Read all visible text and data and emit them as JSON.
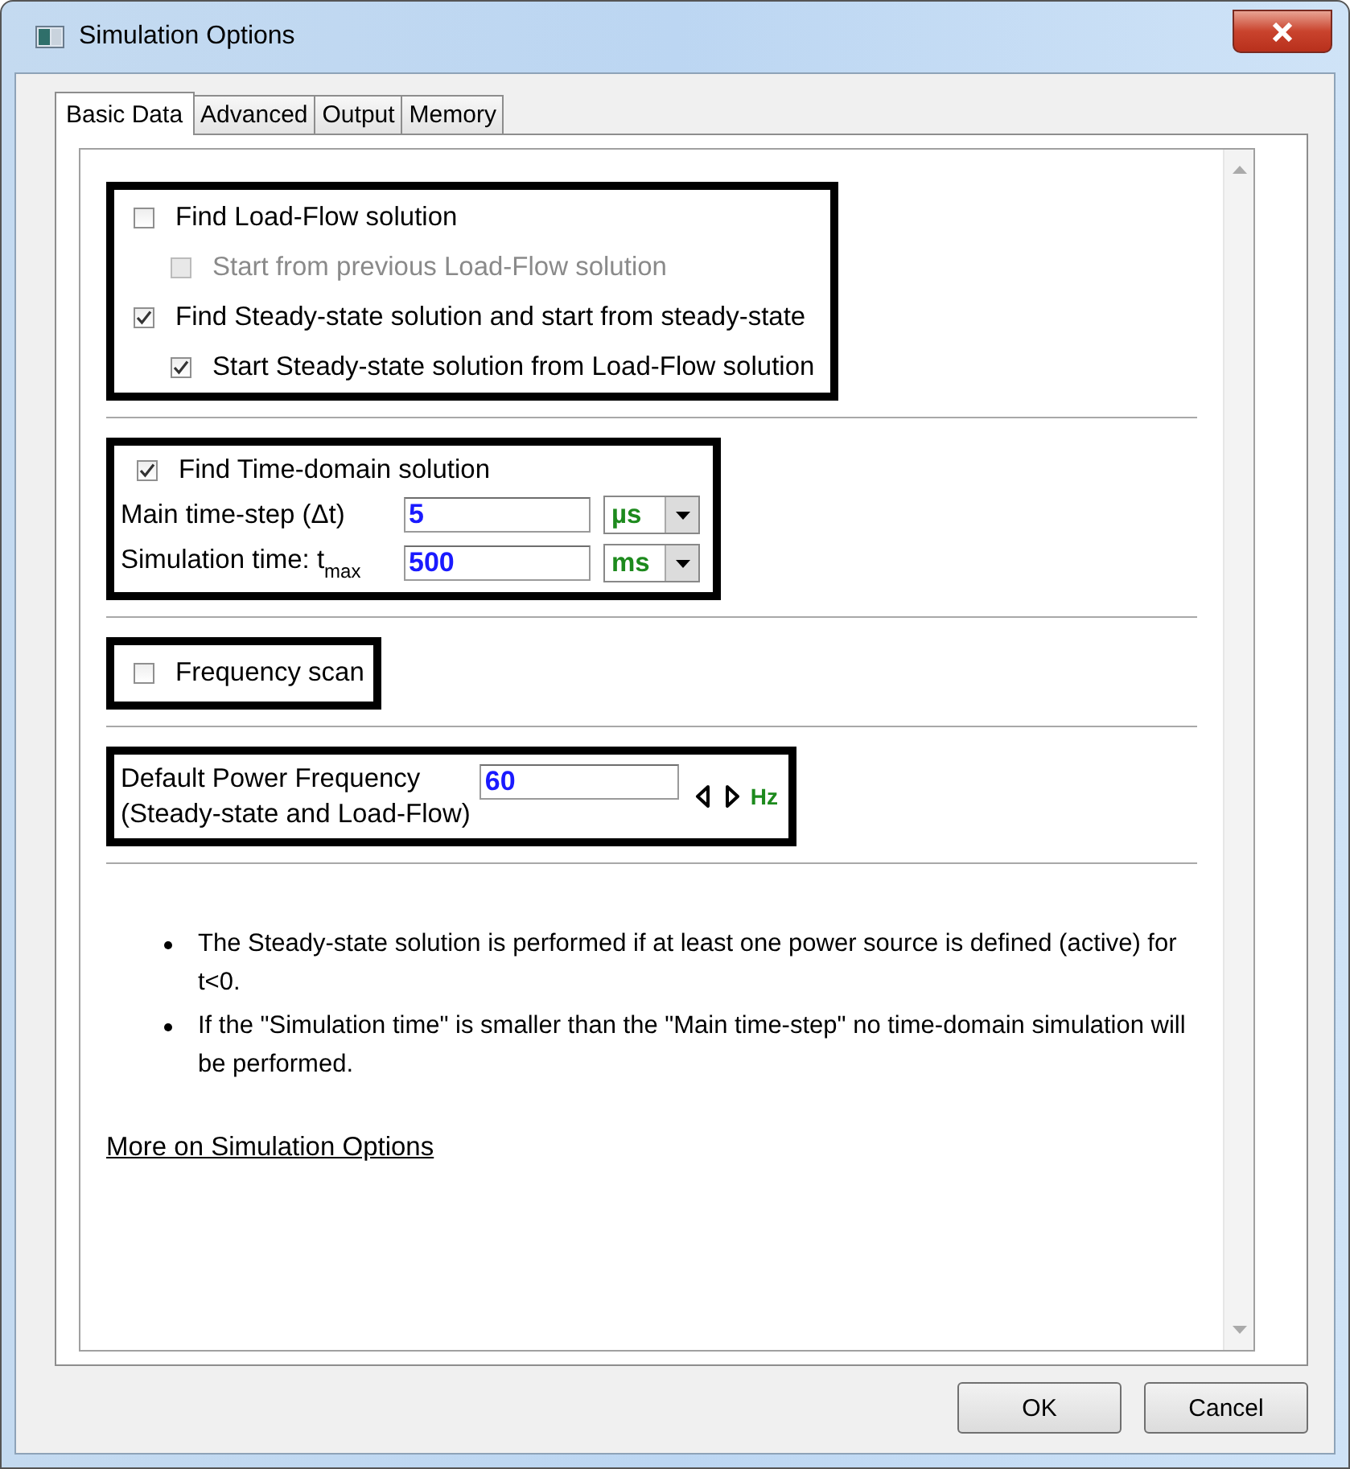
{
  "window": {
    "title": "Simulation Options"
  },
  "tabs": [
    {
      "label": "Basic Data",
      "selected": true
    },
    {
      "label": "Advanced",
      "selected": false
    },
    {
      "label": "Output",
      "selected": false
    },
    {
      "label": "Memory",
      "selected": false
    }
  ],
  "solution_options": [
    {
      "label": "Find Load-Flow solution",
      "checked": false,
      "disabled": false,
      "children": [
        {
          "label": "Start from previous Load-Flow solution",
          "checked": false,
          "disabled": true
        }
      ]
    },
    {
      "label": "Find Steady-state solution and start from steady-state",
      "checked": true,
      "disabled": false,
      "children": [
        {
          "label": "Start Steady-state solution from Load-Flow solution",
          "checked": true,
          "disabled": false
        }
      ]
    }
  ],
  "time_domain": {
    "option": {
      "label": "Find Time-domain solution",
      "checked": true
    },
    "fields": [
      {
        "label": "Main time-step (Δt)",
        "value": "5",
        "unit": "µs"
      },
      {
        "label": "Simulation time: t$_{max}$",
        "value": "500",
        "unit": "ms"
      }
    ]
  },
  "frequency_scan": {
    "label": "Frequency scan",
    "checked": false
  },
  "power_frequency": {
    "label_lines": [
      "Default Power Frequency",
      "(Steady-state and Load-Flow)"
    ],
    "value": "60",
    "unit": "Hz"
  },
  "notes": [
    "The Steady-state solution is performed if at least one power source is defined (active) for t<0.",
    "If the \"Simulation time\" is smaller than the \"Main time-step\" no time-domain simulation will be performed."
  ],
  "link": "More on Simulation Options",
  "buttons": [
    "OK",
    "Cancel"
  ]
}
